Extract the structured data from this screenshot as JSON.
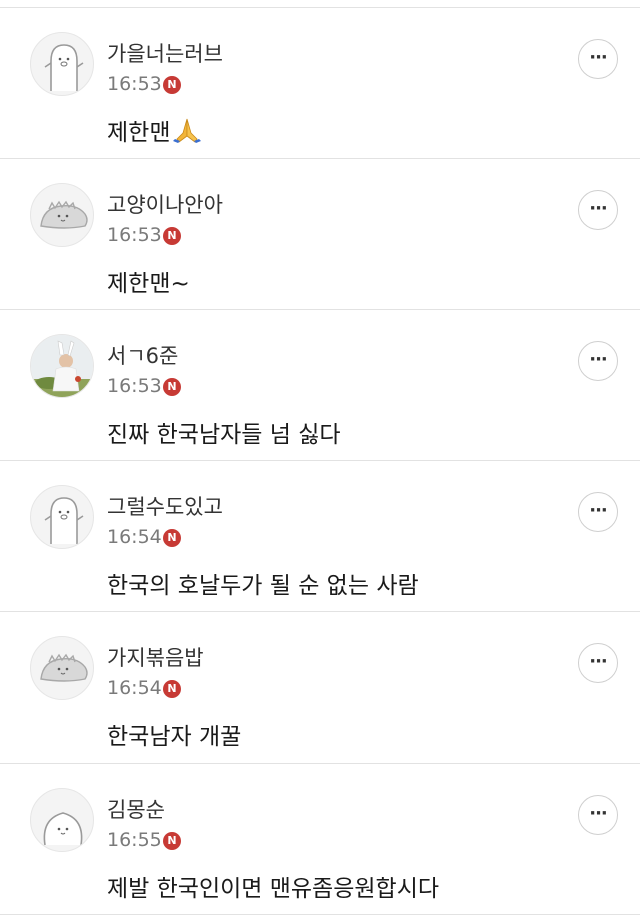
{
  "comments": [
    {
      "author": "가을너는러브",
      "time": "16:53",
      "badge": "N",
      "text": "제한맨",
      "emoji": "folded-hands",
      "avatar": "ghost-character"
    },
    {
      "author": "고양이나안아",
      "time": "16:53",
      "badge": "N",
      "text": "제한맨~",
      "avatar": "dino-character"
    },
    {
      "author": "서ㄱ6준",
      "time": "16:53",
      "badge": "N",
      "text": "진짜 한국남자들 넘 싫다",
      "avatar": "photo"
    },
    {
      "author": "그럴수도있고",
      "time": "16:54",
      "badge": "N",
      "text": "한국의 호날두가 될 순 없는 사람",
      "avatar": "ghost-character"
    },
    {
      "author": "가지볶음밥",
      "time": "16:54",
      "badge": "N",
      "text": "한국남자 개꿀",
      "avatar": "dino-character"
    },
    {
      "author": "김몽순",
      "time": "16:55",
      "badge": "N",
      "text": "제발 한국인이면 맨유좀응원합시다",
      "avatar": "blob-character"
    }
  ],
  "more_button_label": "···"
}
